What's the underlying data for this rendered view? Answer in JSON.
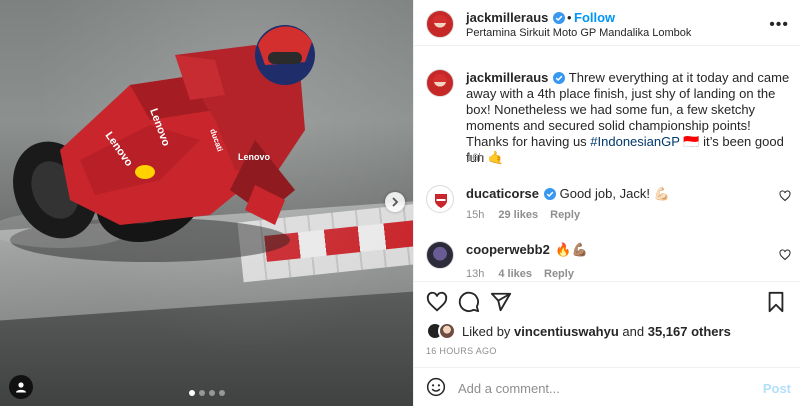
{
  "post": {
    "author": "jackmilleraus",
    "follow_label": "Follow",
    "location": "Pertamina Sirkuit Moto GP Mandalika Lombok"
  },
  "caption": {
    "username": "jackmilleraus",
    "text_before": "Threw everything at it today and came away with a 4th place finish, just shy of landing on the box! Nonetheless we had some fun, a few sketchy moments and secured solid championship points! Thanks for having us ",
    "hashtag": "#IndonesianGP",
    "text_after": " 🇮🇩 it’s been good fun 🤙",
    "time": "16h"
  },
  "comments": [
    {
      "username": "ducaticorse",
      "text": "Good job, Jack! 💪🏻",
      "time": "15h",
      "likes": "29 likes",
      "reply": "Reply"
    },
    {
      "username": "cooperwebb2",
      "text": "🔥💪🏽",
      "time": "13h",
      "likes": "4 likes",
      "reply": "Reply"
    }
  ],
  "likes": {
    "prefix": "Liked by ",
    "user": "vincentiuswahyu",
    "middle": " and ",
    "others": "35,167 others"
  },
  "timestamp": "16 HOURS AGO",
  "composer": {
    "placeholder": "Add a comment...",
    "post_label": "Post"
  },
  "carousel": {
    "slides": 4,
    "active": 1
  },
  "colors": {
    "link_blue": "#0095f6",
    "verified": "#3897f0",
    "ducati_red": "#c8262c"
  },
  "icons": [
    "verified-badge-icon",
    "more-options-icon",
    "heart-icon",
    "comment-icon",
    "share-icon",
    "bookmark-icon",
    "emoji-icon",
    "carousel-next-icon",
    "tagged-user-icon"
  ]
}
